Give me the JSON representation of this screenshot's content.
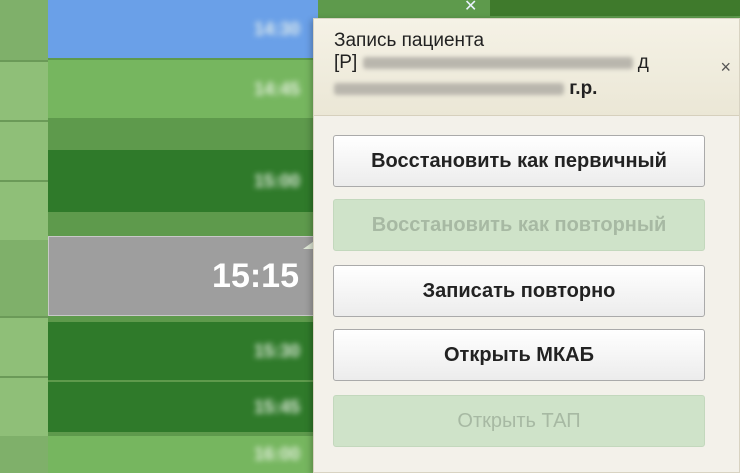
{
  "schedule": {
    "slots": [
      {
        "time": "14:30",
        "style": "blue",
        "blurred": true
      },
      {
        "time": "14:45",
        "style": "g1",
        "blurred": true
      },
      {
        "time": "15:00",
        "style": "g2",
        "blurred": true
      },
      {
        "time": "15:15",
        "style": "grey",
        "blurred": false
      },
      {
        "time": "15:30",
        "style": "g2",
        "blurred": true
      },
      {
        "time": "15:45",
        "style": "g2",
        "blurred": true
      },
      {
        "time": "16:00",
        "style": "g1",
        "blurred": true
      }
    ],
    "selected_time": "15:15"
  },
  "popup": {
    "title": "Запись пациента",
    "line2_prefix": "[Р]",
    "line2_suffix": "д",
    "line3_suffix": "г.р.",
    "close_label": "×",
    "buttons": [
      {
        "label": "Восстановить как первичный",
        "enabled": true
      },
      {
        "label": "Восстановить как повторный",
        "enabled": false
      },
      {
        "label": "Записать повторно",
        "enabled": true
      },
      {
        "label": "Открыть МКАБ",
        "enabled": true
      },
      {
        "label": "Открыть ТАП",
        "enabled": false
      }
    ]
  },
  "colors": {
    "slot_blue": "#6aa0e8",
    "slot_green_light": "#76b65f",
    "slot_green_dark": "#2f7a2a",
    "slot_selected": "#9e9e9e",
    "disabled_button": "#cfe3c9"
  }
}
